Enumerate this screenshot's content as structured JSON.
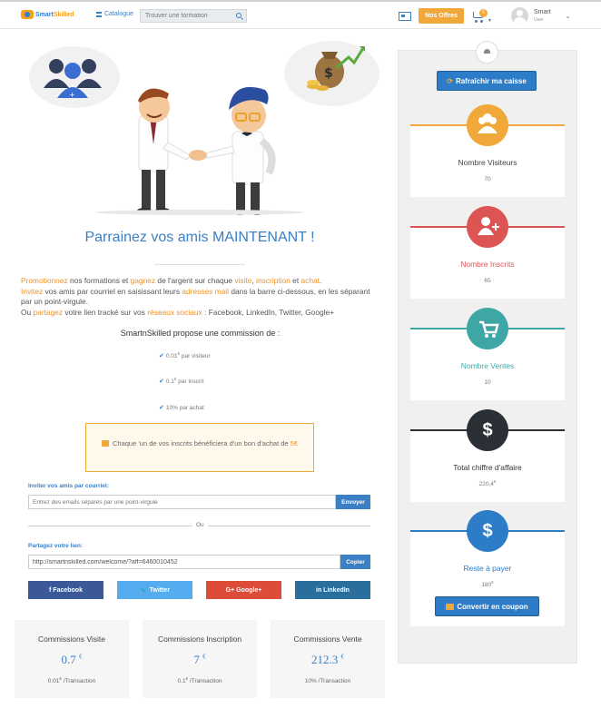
{
  "header": {
    "logo_text": "Smart",
    "logo_text_accent": "Skilled",
    "catalogue": "Catalogue",
    "search_placeholder": "Trouver une formation",
    "offers_button": "Nos Offres",
    "cart_count": "0",
    "user_name": "Smart",
    "user_role": "User"
  },
  "main": {
    "title": "Parrainez vos amis MAINTENANT !",
    "intro": {
      "promote": "Promotionnez",
      "t1": " nos formations et ",
      "gain": "gagnez",
      "t2": " de l'argent sur chaque ",
      "visit": "visite",
      "t3": ", ",
      "signup": "inscription",
      "t4": " et ",
      "purchase": "achat",
      "t5": ".",
      "invite": "Invitez",
      "t6": " vos amis par courriel en saisissant leurs ",
      "emails": "adresses mail",
      "t7": " dans la barre ci-dessous, en les séparant par un point-virgule.",
      "t8": "Ou ",
      "share": "partagez",
      "t9": " votre lien tracké sur vos ",
      "social": "réseaux sociaux",
      "t10": " : Facebook, LinkedIn, Twitter, Google+"
    },
    "commission_title": "SmartnSkilled propose une commission de :",
    "commissions": [
      {
        "value": "0.01",
        "unit": "€",
        "text": " par visiteur"
      },
      {
        "value": "0.1",
        "unit": "€",
        "text": " par inscrit"
      },
      {
        "value": "10%",
        "unit": "",
        "text": " par achat"
      }
    ],
    "voucher_text": "Chaque 'un de vos inscrits bénéficiera d'un bon d'achat de ",
    "voucher_amount": "5€",
    "invite_label": "Inviter vos amis par courriel:",
    "email_placeholder": "Entrez des emails séparés par une point-virgule",
    "send_button": "Envoyer",
    "or": "Ou",
    "share_label": "Partagez votre lien:",
    "share_link": "http://smartnskilled.com/welcome/?aff=6460010452",
    "copy_button": "Copier",
    "social_buttons": {
      "facebook": "f Facebook",
      "twitter": "🐦 Twitter",
      "google": "G+ Google+",
      "linkedin": "in LinkedIn"
    },
    "stats": [
      {
        "title": "Commissions Visite",
        "value": "0.7",
        "unit": "€",
        "detail_value": "0.01",
        "detail_unit": "€",
        "detail_text": " /Transaction"
      },
      {
        "title": "Commissions Inscription",
        "value": "7",
        "unit": "€",
        "detail_value": "0.1",
        "detail_unit": "€",
        "detail_text": " /Transaction"
      },
      {
        "title": "Commissions Vente",
        "value": "212.3",
        "unit": "€",
        "detail_value": "10%",
        "detail_unit": "",
        "detail_text": " /Transaction"
      }
    ]
  },
  "sidebar": {
    "refresh_button": "Rafraîchir ma caisse",
    "cards": [
      {
        "title": "Nombre Visiteurs",
        "value": "70",
        "unit": "",
        "color": "#f0a83a",
        "title_color": "#444444",
        "icon": "users-icon"
      },
      {
        "title": "Nombre Inscrits",
        "value": "65",
        "unit": "",
        "color": "#dd5454",
        "title_color": "#dd5454",
        "icon": "user-plus-icon"
      },
      {
        "title": "Nombre Ventes",
        "value": "10",
        "unit": "",
        "color": "#3fa6a6",
        "title_color": "#3fa6a6",
        "icon": "cart-icon"
      },
      {
        "title": "Total chiffre d'affaire",
        "value": "220,4",
        "unit": "€",
        "color": "#2b2f36",
        "title_color": "#333333",
        "icon": "dollar-icon"
      },
      {
        "title": "Reste à payer",
        "value": "180",
        "unit": "€",
        "color": "#2d7cc7",
        "title_color": "#2d7cc7",
        "icon": "dollar-icon"
      }
    ],
    "coupon_button": "Convertir en coupon"
  }
}
